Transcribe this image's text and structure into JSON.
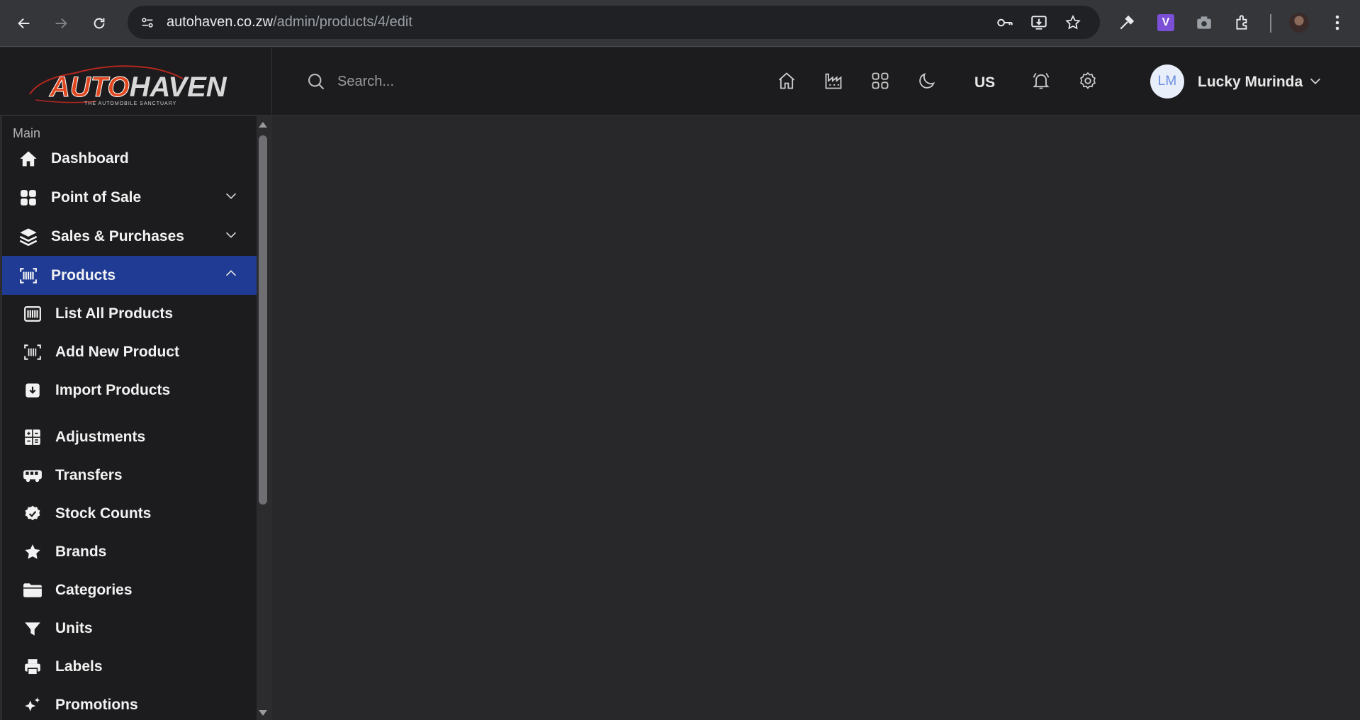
{
  "browser": {
    "url_domain": "autohaven.co.zw",
    "url_path": "/admin/products/4/edit",
    "extension_v_label": "V"
  },
  "brand": {
    "logo_part1": "AUTO",
    "logo_part2": "HAVEN",
    "tagline": "THE AUTOMOBILE SANCTUARY"
  },
  "header": {
    "search_placeholder": "Search...",
    "language": "US",
    "user_initials": "LM",
    "user_name": "Lucky Murinda"
  },
  "sidebar": {
    "section": "Main",
    "items": [
      {
        "label": "Dashboard",
        "icon": "home-icon"
      },
      {
        "label": "Point of Sale",
        "icon": "grid-icon",
        "expandable": true
      },
      {
        "label": "Sales & Purchases",
        "icon": "layers-icon",
        "expandable": true
      },
      {
        "label": "Products",
        "icon": "barcode-icon",
        "expandable": true,
        "expanded": true,
        "active": true
      }
    ],
    "sub_items": [
      {
        "label": "List All Products",
        "icon": "barcode-icon"
      },
      {
        "label": "Add New Product",
        "icon": "barcode-scan-icon"
      },
      {
        "label": "Import Products",
        "icon": "import-icon"
      },
      {
        "label": "Adjustments",
        "icon": "calculator-icon"
      },
      {
        "label": "Transfers",
        "icon": "truck-icon"
      },
      {
        "label": "Stock Counts",
        "icon": "check-badge-icon"
      },
      {
        "label": "Brands",
        "icon": "star-icon"
      },
      {
        "label": "Categories",
        "icon": "folder-icon"
      },
      {
        "label": "Units",
        "icon": "filter-icon"
      },
      {
        "label": "Labels",
        "icon": "printer-icon"
      },
      {
        "label": "Promotions",
        "icon": "sparkles-icon"
      }
    ]
  },
  "colors": {
    "active_item": "#1f3b94",
    "sidebar_bg": "#1c1c1e",
    "content_bg": "#28282b",
    "logo_accent": "#e0471f"
  }
}
